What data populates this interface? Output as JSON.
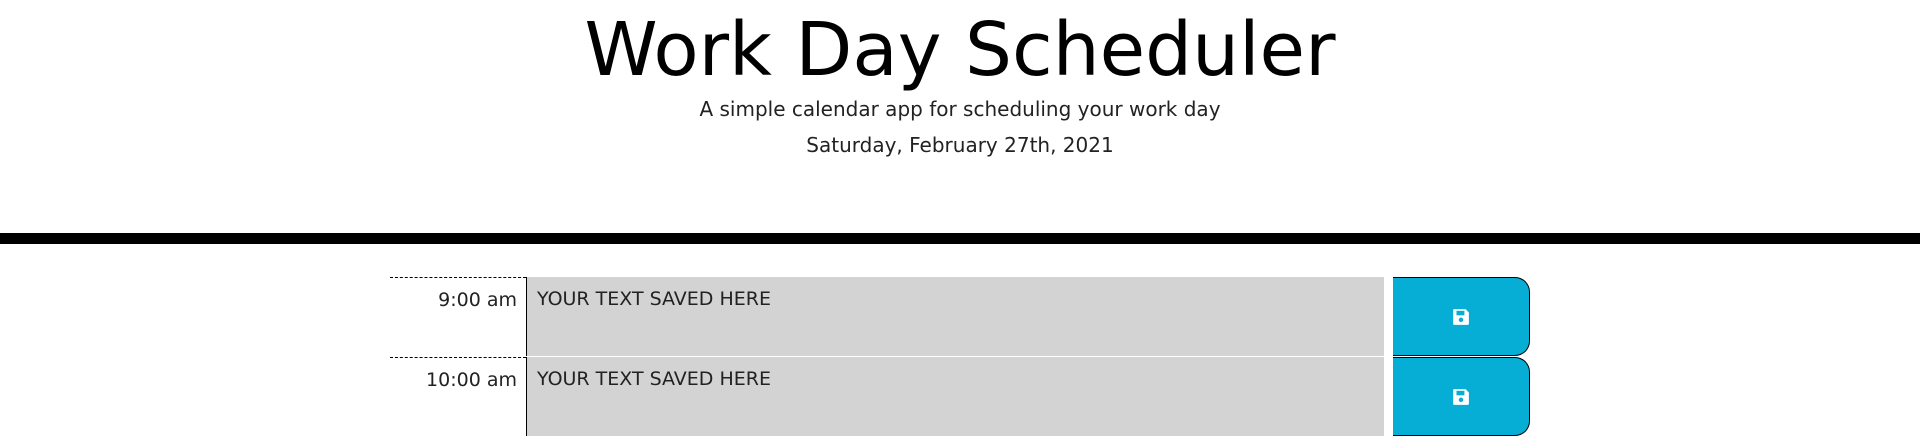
{
  "header": {
    "title": "Work Day Scheduler",
    "subtitle": "A simple calendar app for scheduling your work day",
    "current_day": "Saturday, February 27th, 2021"
  },
  "colors": {
    "past_block": "#d3d3d3",
    "save_button": "#06aed5",
    "divider": "#000000"
  },
  "time_blocks": [
    {
      "hour_label": "9:00 am",
      "description": "YOUR TEXT SAVED HERE",
      "save_icon": "save-icon"
    },
    {
      "hour_label": "10:00 am",
      "description": "YOUR TEXT SAVED HERE",
      "save_icon": "save-icon"
    }
  ]
}
